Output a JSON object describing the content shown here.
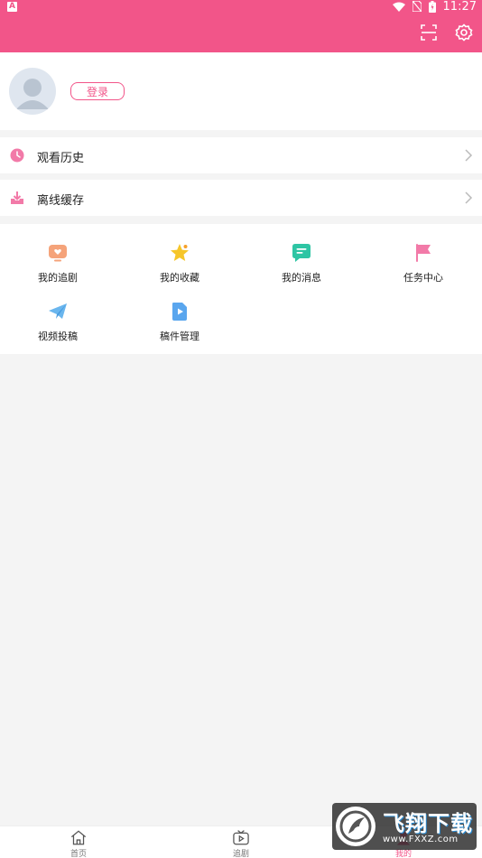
{
  "status_bar": {
    "time": "11:27",
    "notification_letter": "A"
  },
  "profile": {
    "login_label": "登录"
  },
  "menu": [
    {
      "label": "观看历史",
      "icon": "clock-icon"
    },
    {
      "label": "离线缓存",
      "icon": "download-icon"
    }
  ],
  "grid": [
    {
      "label": "我的追剧",
      "icon": "tv-heart-icon"
    },
    {
      "label": "我的收藏",
      "icon": "star-icon"
    },
    {
      "label": "我的消息",
      "icon": "message-icon"
    },
    {
      "label": "任务中心",
      "icon": "flag-icon"
    },
    {
      "label": "视频投稿",
      "icon": "paper-plane-icon"
    },
    {
      "label": "稿件管理",
      "icon": "video-file-icon"
    }
  ],
  "bottom_nav": [
    {
      "label": "首页",
      "icon": "home-icon",
      "active": false
    },
    {
      "label": "追剧",
      "icon": "tv-play-icon",
      "active": false
    },
    {
      "label": "我的",
      "icon": "user-icon",
      "active": true
    }
  ],
  "watermark": {
    "title": "飞翔下载",
    "url": "www.FXXZ.com"
  },
  "colors": {
    "accent": "#f25589",
    "background": "#f4f4f4",
    "surface": "#ffffff"
  }
}
